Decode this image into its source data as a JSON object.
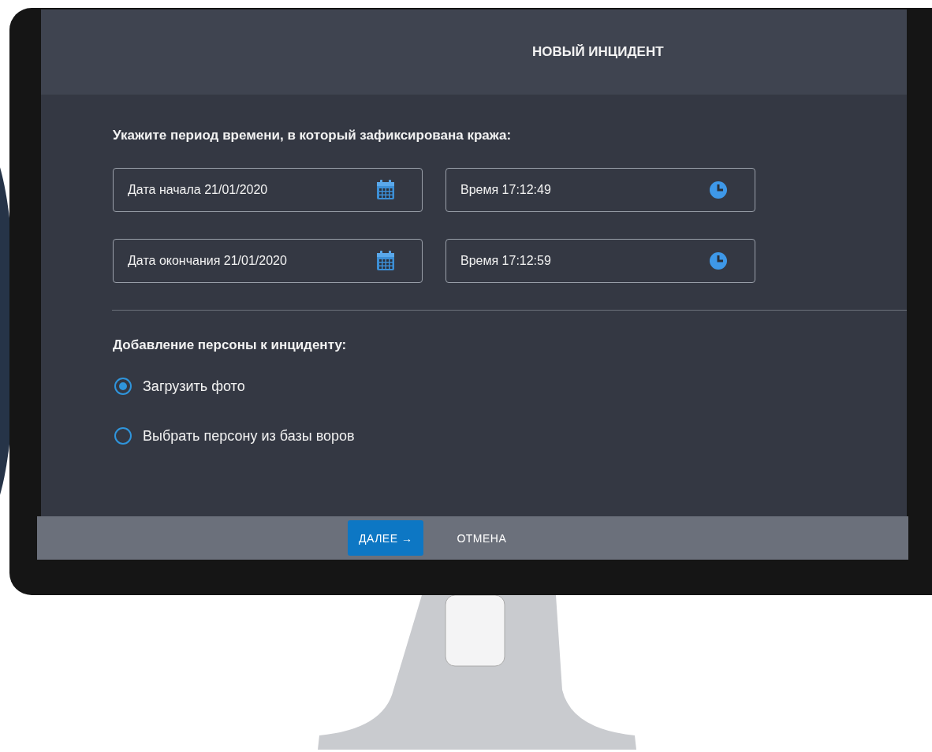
{
  "window": {
    "title": "НОВЫЙ ИНЦИДЕНТ"
  },
  "period": {
    "heading": "Укажите период времени, в который зафиксирована кража:",
    "rows": [
      {
        "date": {
          "value": "Дата начала 21/01/2020"
        },
        "time": {
          "value": "Время 17:12:49"
        }
      },
      {
        "date": {
          "value": "Дата окончания 21/01/2020"
        },
        "time": {
          "value": "Время 17:12:59"
        }
      }
    ]
  },
  "person": {
    "heading": "Добавление персоны к инциденту:",
    "options": [
      {
        "label": "Загрузить фото",
        "selected": true
      },
      {
        "label": "Выбрать персону из базы воров",
        "selected": false
      }
    ]
  },
  "buttons": [
    {
      "label": "ДАЛЕЕ →",
      "kind": "primary"
    },
    {
      "label": "ОТМЕНА",
      "kind": "flat"
    }
  ]
}
